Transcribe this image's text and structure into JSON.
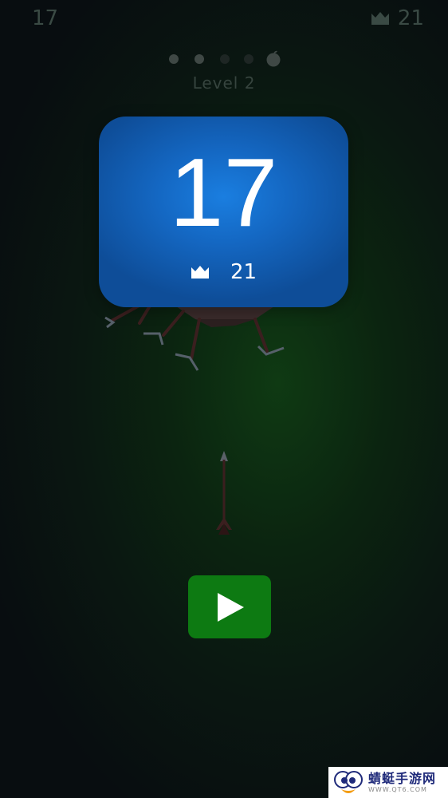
{
  "hud": {
    "score": "17",
    "best": "21",
    "crown_icon": "crown-icon"
  },
  "level": {
    "label": "Level 2",
    "stages": [
      {
        "state": "done",
        "color": "#3f4845"
      },
      {
        "state": "done",
        "color": "#3f4845"
      },
      {
        "state": "pending",
        "color": "#1e2624"
      },
      {
        "state": "pending",
        "color": "#1e2624"
      },
      {
        "state": "boss",
        "color": "#3f4845"
      }
    ],
    "current_stage": 2,
    "total_stages": 5
  },
  "score_card": {
    "score": "17",
    "best": "21",
    "background_color": "#1467c2"
  },
  "play_button": {
    "icon": "play-icon",
    "background_color": "#0d7a12"
  },
  "watermark": {
    "title": "蜻蜓手游网",
    "url": "WWW.QT6.COM"
  }
}
